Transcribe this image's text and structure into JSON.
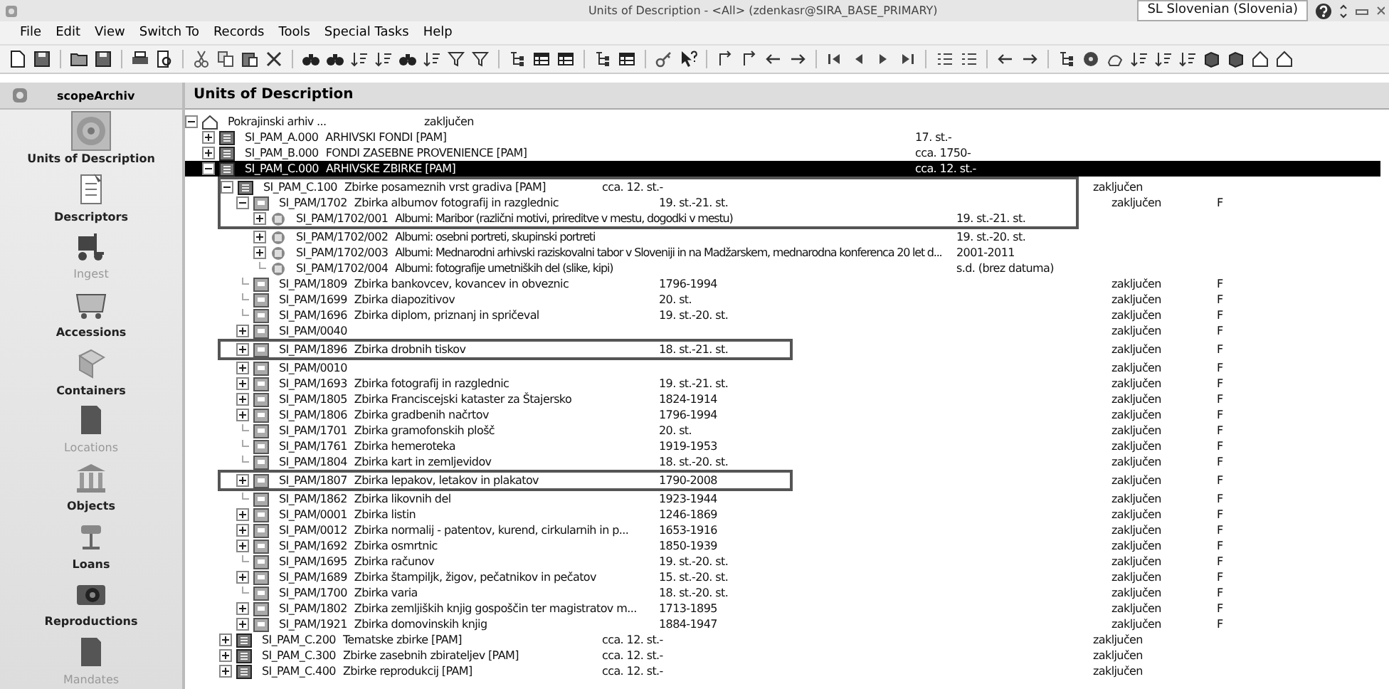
{
  "window": {
    "title": "Units of Description - <All> (zdenkasr@SIRA_BASE_PRIMARY)",
    "language": "SL Slovenian (Slovenia)"
  },
  "menu": [
    "File",
    "Edit",
    "View",
    "Switch To",
    "Records",
    "Tools",
    "Special Tasks",
    "Help"
  ],
  "sidebar": {
    "title": "scopeArchiv",
    "items": [
      {
        "label": "Units of Description",
        "selected": true,
        "disabled": false
      },
      {
        "label": "Descriptors",
        "selected": false,
        "disabled": false
      },
      {
        "label": "Ingest",
        "selected": false,
        "disabled": true
      },
      {
        "label": "Accessions",
        "selected": false,
        "disabled": false
      },
      {
        "label": "Containers",
        "selected": false,
        "disabled": false
      },
      {
        "label": "Locations",
        "selected": false,
        "disabled": true
      },
      {
        "label": "Objects",
        "selected": false,
        "disabled": false
      },
      {
        "label": "Loans",
        "selected": false,
        "disabled": false
      },
      {
        "label": "Reproductions",
        "selected": false,
        "disabled": false
      },
      {
        "label": "Mandates",
        "selected": false,
        "disabled": true
      }
    ]
  },
  "panel": {
    "title": "Units of Description"
  },
  "tree": {
    "rows": [
      {
        "kind": "archive",
        "title": "Pokrajinski arhiv ...",
        "status": "zaključen",
        "expandable": true,
        "expanded": true,
        "selected": false,
        "boxed": false,
        "children": [
          {
            "kind": "collection",
            "id": "SI_PAM_A.000",
            "title": "ARHIVSKI FONDI  [PAM]",
            "date": "17. st.-",
            "expandable": true,
            "expanded": false,
            "selected": false,
            "boxed": false
          },
          {
            "kind": "collection",
            "id": "SI_PAM_B.000",
            "title": "FONDI ZASEBNE PROVENIENCE [PAM]",
            "date": "cca. 1750-",
            "expandable": true,
            "expanded": false,
            "selected": false,
            "boxed": false
          },
          {
            "kind": "collection",
            "id": "SI_PAM_C.000",
            "title": "ARHIVSKE ZBIRKE  [PAM]",
            "date": "cca. 12. st.-",
            "expandable": true,
            "expanded": true,
            "selected": true,
            "boxed": false,
            "children": [
              {
                "kind": "collection",
                "id": "SI_PAM_C.100",
                "title": "Zbirke posameznih vrst gradiva  [PAM]",
                "date": "cca. 12. st.-",
                "status": "zaključen",
                "expandable": true,
                "expanded": true,
                "selected": false,
                "boxed": true,
                "children": [
                  {
                    "kind": "series",
                    "id": "SI_PAM/1702",
                    "title": "Zbirka albumov fotografij in razglednic",
                    "date": "19. st.-21. st.",
                    "status": "zaključen",
                    "flag": "F",
                    "expandable": true,
                    "expanded": true,
                    "selected": false,
                    "boxed": true,
                    "children": [
                      {
                        "kind": "album",
                        "id": "SI_PAM/1702/001",
                        "title": "Albumi: Maribor (različni motivi, prireditve v mestu, dogodki v mestu)",
                        "date": "19. st.-21. st.",
                        "expandable": true,
                        "expanded": false,
                        "selected": false,
                        "boxed": true
                      },
                      {
                        "kind": "album",
                        "id": "SI_PAM/1702/002",
                        "title": "Albumi: osebni portreti, skupinski portreti",
                        "date": "19. st.-20. st.",
                        "expandable": true,
                        "expanded": false,
                        "selected": false,
                        "boxed": false
                      },
                      {
                        "kind": "album",
                        "id": "SI_PAM/1702/003",
                        "title": "Albumi: Mednarodni arhivski raziskovalni tabor v Sloveniji in na Madžarskem, mednarodna konferenca 20 let d...",
                        "date": "2001-2011",
                        "expandable": true,
                        "expanded": false,
                        "selected": false,
                        "boxed": false
                      },
                      {
                        "kind": "album",
                        "id": "SI_PAM/1702/004",
                        "title": "Albumi: fotografije umetniških del (slike, kipi)",
                        "date": "s.d. (brez datuma)",
                        "expandable": false,
                        "selected": false,
                        "boxed": false
                      }
                    ]
                  },
                  {
                    "kind": "series",
                    "id": "SI_PAM/1809",
                    "title": "Zbirka bankovcev, kovancev in obveznic",
                    "date": "1796-1994",
                    "status": "zaključen",
                    "flag": "F",
                    "expandable": false,
                    "selected": false,
                    "boxed": false
                  },
                  {
                    "kind": "series",
                    "id": "SI_PAM/1699",
                    "title": "Zbirka diapozitivov",
                    "date": "20. st.",
                    "status": "zaključen",
                    "flag": "F",
                    "expandable": false,
                    "selected": false,
                    "boxed": false
                  },
                  {
                    "kind": "series",
                    "id": "SI_PAM/1696",
                    "title": "Zbirka diplom, priznanj in spričeval",
                    "date": "19. st.-20. st.",
                    "status": "zaključen",
                    "flag": "F",
                    "expandable": false,
                    "selected": false,
                    "boxed": false
                  },
                  {
                    "kind": "series",
                    "id": "SI_PAM/0040",
                    "status": "zaključen",
                    "flag": "F",
                    "expandable": true,
                    "expanded": false,
                    "selected": false,
                    "boxed": false
                  },
                  {
                    "kind": "series",
                    "id": "SI_PAM/1896",
                    "title": "Zbirka drobnih tiskov",
                    "date": "18. st.-21. st.",
                    "status": "zaključen",
                    "flag": "F",
                    "expandable": true,
                    "expanded": false,
                    "selected": false,
                    "boxed": true
                  },
                  {
                    "kind": "series",
                    "id": "SI_PAM/0010",
                    "status": "zaključen",
                    "flag": "F",
                    "expandable": true,
                    "expanded": false,
                    "selected": false,
                    "boxed": false
                  },
                  {
                    "kind": "series",
                    "id": "SI_PAM/1693",
                    "title": "Zbirka fotografij in razglednic",
                    "date": "19. st.-21. st.",
                    "status": "zaključen",
                    "flag": "F",
                    "expandable": true,
                    "expanded": false,
                    "selected": false,
                    "boxed": false
                  },
                  {
                    "kind": "series",
                    "id": "SI_PAM/1805",
                    "title": "Zbirka Franciscejski kataster za Štajersko",
                    "date": "1824-1914",
                    "status": "zaključen",
                    "flag": "F",
                    "expandable": true,
                    "expanded": false,
                    "selected": false,
                    "boxed": false
                  },
                  {
                    "kind": "series",
                    "id": "SI_PAM/1806",
                    "title": "Zbirka gradbenih načrtov",
                    "date": "1796-1994",
                    "status": "zaključen",
                    "flag": "F",
                    "expandable": true,
                    "expanded": false,
                    "selected": false,
                    "boxed": false
                  },
                  {
                    "kind": "series",
                    "id": "SI_PAM/1701",
                    "title": "Zbirka gramofonskih plošč",
                    "date": "20. st.",
                    "status": "zaključen",
                    "flag": "F",
                    "expandable": false,
                    "selected": false,
                    "boxed": false
                  },
                  {
                    "kind": "series",
                    "id": "SI_PAM/1761",
                    "title": "Zbirka hemeroteka",
                    "date": "1919-1953",
                    "status": "zaključen",
                    "flag": "F",
                    "expandable": false,
                    "selected": false,
                    "boxed": false
                  },
                  {
                    "kind": "series",
                    "id": "SI_PAM/1804",
                    "title": "Zbirka kart in zemljevidov",
                    "date": "18. st.-20. st.",
                    "status": "zaključen",
                    "flag": "F",
                    "expandable": false,
                    "selected": false,
                    "boxed": false
                  },
                  {
                    "kind": "series",
                    "id": "SI_PAM/1807",
                    "title": "Zbirka lepakov, letakov in plakatov",
                    "date": "1790-2008",
                    "status": "zaključen",
                    "flag": "F",
                    "expandable": true,
                    "expanded": false,
                    "selected": false,
                    "boxed": true
                  },
                  {
                    "kind": "series",
                    "id": "SI_PAM/1862",
                    "title": "Zbirka likovnih del",
                    "date": "1923-1944",
                    "status": "zaključen",
                    "flag": "F",
                    "expandable": false,
                    "selected": false,
                    "boxed": false
                  },
                  {
                    "kind": "series",
                    "id": "SI_PAM/0001",
                    "title": "Zbirka listin",
                    "date": "1246-1869",
                    "status": "zaključen",
                    "flag": "F",
                    "expandable": true,
                    "expanded": false,
                    "selected": false,
                    "boxed": false
                  },
                  {
                    "kind": "series",
                    "id": "SI_PAM/0012",
                    "title": "Zbirka normalij - patentov, kurend, cirkularnih in p...",
                    "date": "1653-1916",
                    "status": "zaključen",
                    "flag": "F",
                    "expandable": true,
                    "expanded": false,
                    "selected": false,
                    "boxed": false
                  },
                  {
                    "kind": "series",
                    "id": "SI_PAM/1692",
                    "title": "Zbirka osmrtnic",
                    "date": "1850-1939",
                    "status": "zaključen",
                    "flag": "F",
                    "expandable": true,
                    "expanded": false,
                    "selected": false,
                    "boxed": false
                  },
                  {
                    "kind": "series",
                    "id": "SI_PAM/1695",
                    "title": "Zbirka računov",
                    "date": "19. st.-20. st.",
                    "status": "zaključen",
                    "flag": "F",
                    "expandable": false,
                    "selected": false,
                    "boxed": false
                  },
                  {
                    "kind": "series",
                    "id": "SI_PAM/1689",
                    "title": "Zbirka štampiljk, žigov, pečatnikov in pečatov",
                    "date": "15. st.-20. st.",
                    "status": "zaključen",
                    "flag": "F",
                    "expandable": true,
                    "expanded": false,
                    "selected": false,
                    "boxed": false
                  },
                  {
                    "kind": "series",
                    "id": "SI_PAM/1700",
                    "title": "Zbirka varia",
                    "date": "18. st.-20. st.",
                    "status": "zaključen",
                    "flag": "F",
                    "expandable": false,
                    "selected": false,
                    "boxed": false
                  },
                  {
                    "kind": "series",
                    "id": "SI_PAM/1802",
                    "title": "Zbirka zemljiških knjig gospoščin ter magistratov m...",
                    "date": "1713-1895",
                    "status": "zaključen",
                    "flag": "F",
                    "expandable": true,
                    "expanded": false,
                    "selected": false,
                    "boxed": false
                  },
                  {
                    "kind": "series",
                    "id": "SI_PAM/1921",
                    "title": "Zbirka domovinskih knjig",
                    "date": "1884-1947",
                    "status": "zaključen",
                    "flag": "F",
                    "expandable": true,
                    "expanded": false,
                    "selected": false,
                    "boxed": false
                  }
                ]
              },
              {
                "kind": "collection",
                "id": "SI_PAM_C.200",
                "title": "Tematske zbirke  [PAM]",
                "date": "cca. 12. st.-",
                "status": "zaključen",
                "expandable": true,
                "expanded": false,
                "selected": false,
                "boxed": false
              },
              {
                "kind": "collection",
                "id": "SI_PAM_C.300",
                "title": "Zbirke zasebnih zbirateljev  [PAM]",
                "date": "cca. 12. st.-",
                "status": "zaključen",
                "expandable": true,
                "expanded": false,
                "selected": false,
                "boxed": false
              },
              {
                "kind": "collection",
                "id": "SI_PAM_C.400",
                "title": "Zbirke reprodukcij [PAM]",
                "date": "cca. 12. st.-",
                "status": "zaključen",
                "expandable": true,
                "expanded": false,
                "selected": false,
                "boxed": false
              }
            ]
          }
        ]
      }
    ]
  }
}
